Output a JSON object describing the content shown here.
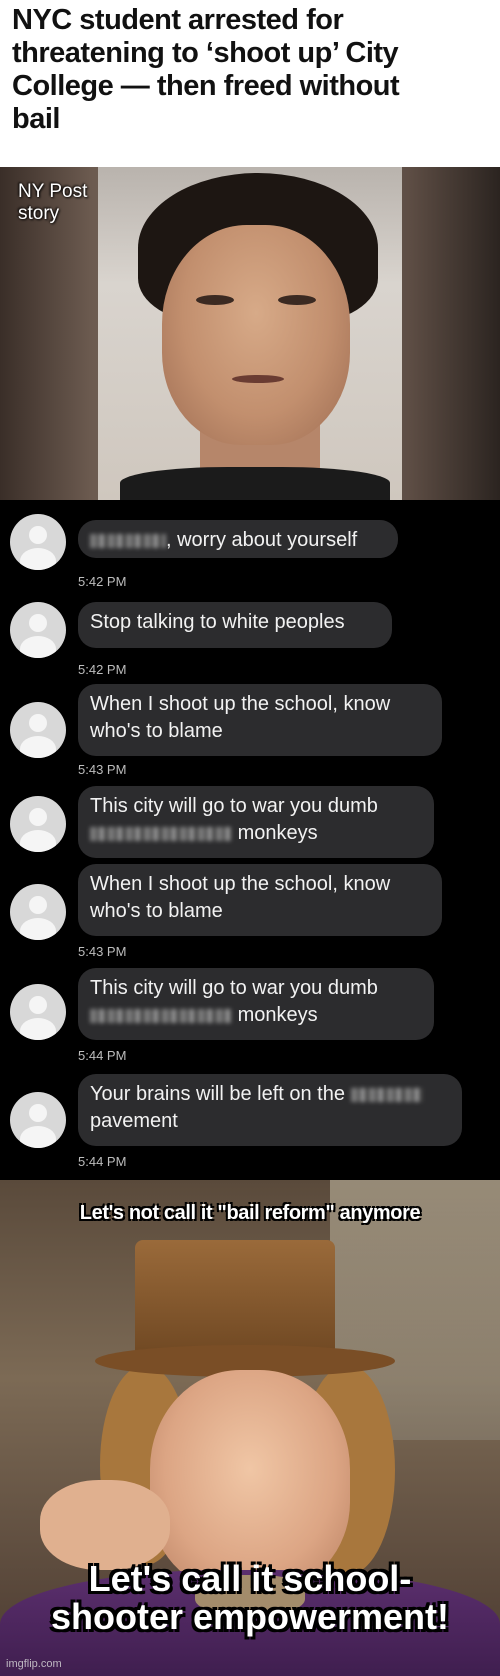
{
  "headline": {
    "line1": "NYC student arrested for",
    "line2": "threatening to ‘shoot up’ City",
    "line3": "College — then freed without",
    "line4": "bail"
  },
  "photo": {
    "caption_line1": "NY Post",
    "caption_line2": "story"
  },
  "messages": [
    {
      "pre": "",
      "text": ", worry about yourself",
      "time": "5:42 PM"
    },
    {
      "text": "Stop talking to white peoples",
      "time": "5:42 PM"
    },
    {
      "line1": "When I shoot up the school, know",
      "line2": "who's to blame",
      "time": "5:43 PM"
    },
    {
      "line1": "This city will go to war you dumb",
      "line2": "monkeys"
    },
    {
      "line1": "When I shoot up the school, know",
      "line2": "who's to blame",
      "time": "5:43 PM"
    },
    {
      "line1": "This city will go to war you dumb",
      "line2": "monkeys",
      "time": "5:44 PM"
    },
    {
      "line1": "Your brains will be left on the",
      "line2": "pavement",
      "time": "5:44 PM"
    }
  ],
  "meme": {
    "top_text": "Let's not call it \"bail reform\" anymore",
    "bottom_line1": "Let's call it school-",
    "bottom_line2": "shooter empowerment!",
    "watermark": "imgflip.com"
  }
}
